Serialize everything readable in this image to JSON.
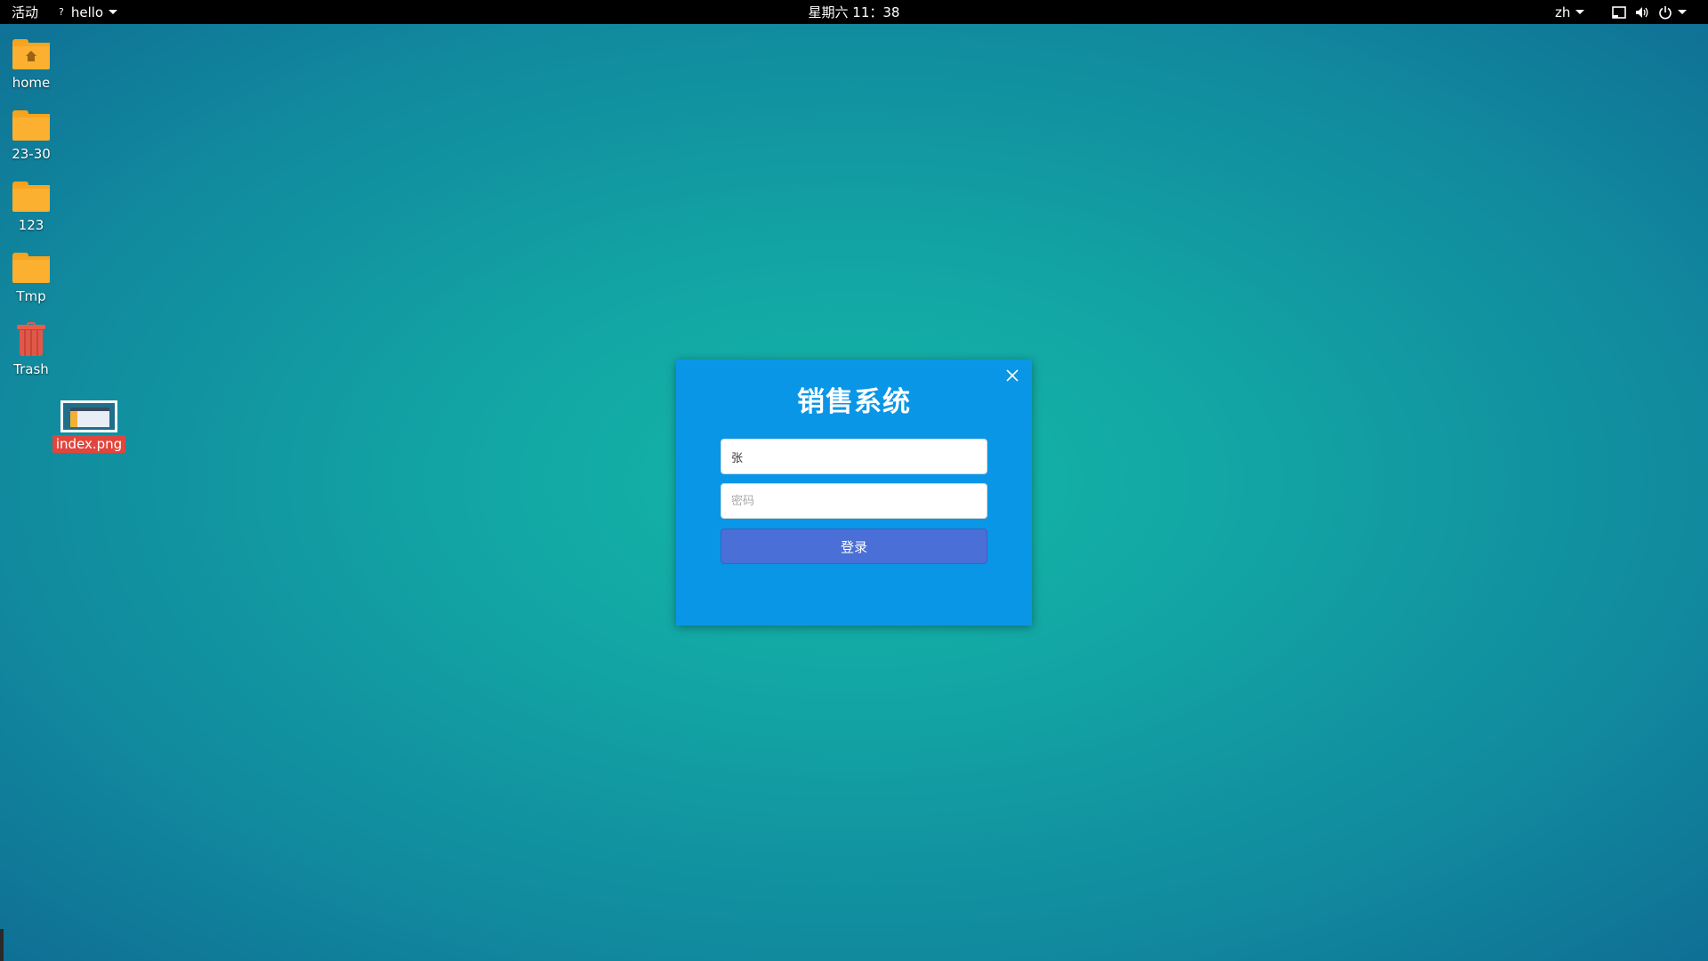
{
  "topbar": {
    "activities": "活动",
    "app_icon": "question-mark-icon",
    "app_name": "hello",
    "clock": "星期六 11：38",
    "language": "zh",
    "tray_icons": [
      "window-icon",
      "volume-icon",
      "power-icon"
    ]
  },
  "desktop": {
    "icons": [
      {
        "label": "home",
        "icon": "home-folder-icon"
      },
      {
        "label": "23-30",
        "icon": "folder-icon"
      },
      {
        "label": "123",
        "icon": "folder-icon"
      },
      {
        "label": "Tmp",
        "icon": "folder-icon"
      },
      {
        "label": "Trash",
        "icon": "trash-icon"
      },
      {
        "label": "index.png",
        "icon": "image-file-icon",
        "selected": true
      }
    ]
  },
  "dialog": {
    "title": "销售系统",
    "username_value": "张",
    "password_placeholder": "密码",
    "login_label": "登录",
    "close_icon": "close-icon"
  },
  "colors": {
    "dialog_bg": "#0a96e6",
    "button_bg": "#4a6fd6",
    "desktop_teal": "#14b8a6",
    "selection_red": "#e2453c"
  }
}
